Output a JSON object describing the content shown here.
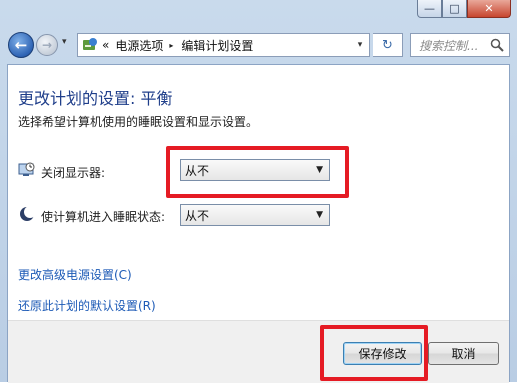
{
  "window": {
    "caption_buttons": {
      "minimize": "—",
      "maximize": "□",
      "close": "✕"
    },
    "close_color": "#c7452e"
  },
  "nav": {
    "back_glyph": "←",
    "forward_glyph": "→",
    "history_dropdown_glyph": "▾",
    "address": {
      "icon": "control-panel-icon",
      "overflow": "«",
      "breadcrumbs": [
        "电源选项",
        "编辑计划设置"
      ],
      "separator": "▸",
      "dropdown_glyph": "▾"
    },
    "refresh_glyph": "↻",
    "search": {
      "placeholder": "搜索控制...",
      "icon": "magnifier-icon"
    }
  },
  "page": {
    "title": "更改计划的设置: 平衡",
    "subtitle": "选择希望计算机使用的睡眠设置和显示设置。",
    "settings": [
      {
        "label": "关闭显示器:",
        "icon": "display-clock-icon",
        "value": "从不"
      },
      {
        "label": "使计算机进入睡眠状态:",
        "icon": "moon-sleep-icon",
        "value": "从不"
      }
    ],
    "links": [
      "更改高级电源设置(C)",
      "还原此计划的默认设置(R)"
    ]
  },
  "footer": {
    "save_label": "保存修改",
    "cancel_label": "取消"
  },
  "highlight_color": "#e51b24",
  "title_color": "#1f3e8a",
  "link_color": "#1c5ab6"
}
